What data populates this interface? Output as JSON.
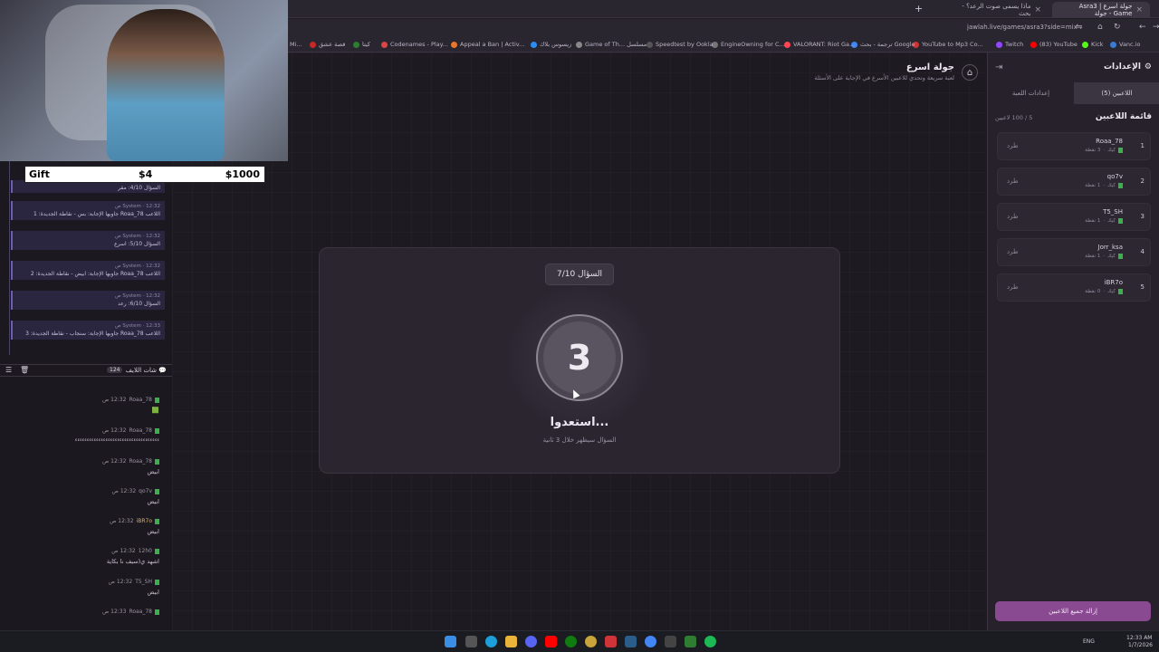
{
  "browser": {
    "tabs": [
      {
        "label": "جولة اسرع | Asra3 Game - جولة",
        "active": true
      },
      {
        "label": "ماذا يسمى صوت الرعد؟ - بحث",
        "active": false
      }
    ],
    "new_tab": "+",
    "url": "jawlah.live/games/asra3?side=mix",
    "bookmarks": [
      "Twitch",
      "(83) YouTube",
      "Kick",
      "Vanc.io",
      "YouTube to Mp3 Co...",
      "ترجمة - بحث Google",
      "VALORANT: Riot Ga...",
      "EngineOwning for C...",
      "Speedtest by Ookla",
      "Game of Th... مسلسل",
      "زيسوس بلاك",
      "Appeal a Ban | Activ...",
      "Codenames - Play...",
      "كيتا",
      "قصة عشق",
      "Mi..."
    ],
    "bookmark_colors": [
      "#9146ff",
      "#ff0000",
      "#53fc18",
      "#3a7bd5",
      "#cc3333",
      "#4285f4",
      "#ff4655",
      "#555",
      "#333",
      "#888",
      "#2b8cf2",
      "#e8762c",
      "#dd4444",
      "#2e7d32",
      "#c62828",
      "#666"
    ]
  },
  "page": {
    "title": "جولة اسرع",
    "subtitle": "لعبة سريعة وتحدي للاعبين الأسرع في الإجابة على الأسئلة",
    "question_badge": "السؤال 7/10",
    "countdown": "3",
    "ready_text": "استعدوا...",
    "ready_sub": "السؤال سيظهر خلال 3 ثانية"
  },
  "settings": {
    "title": "الإعدادات",
    "tab_players": "اللاعبين (5)",
    "tab_game": "إعدادات اللعبة",
    "players_title": "قائمة اللاعبين",
    "players_count": "5 / 100 لاعبين",
    "kick_label": "طرد",
    "players": [
      {
        "num": "1",
        "name": "Roaa_78",
        "status": "3 نقطة",
        "state": "كيك"
      },
      {
        "num": "2",
        "name": "qo7v",
        "status": "1 نقطة",
        "state": "كيك"
      },
      {
        "num": "3",
        "name": "T5_SH",
        "status": "1 نقطة",
        "state": "كيك"
      },
      {
        "num": "4",
        "name": "Jorr_ksa",
        "status": "1 نقطة",
        "state": "كيك"
      },
      {
        "num": "5",
        "name": "iBR7o",
        "status": "0 نقطة",
        "state": "كيك"
      }
    ],
    "remove_all": "إزالة جميع اللاعبين"
  },
  "overlay": {
    "gift_label": "Gift",
    "gift_amount": "$4",
    "gift_goal": "$1000"
  },
  "system_log": [
    {
      "time": "12:32 ص",
      "who": "System",
      "text": "السؤال 4/10: مقر"
    },
    {
      "time": "12:32 ص",
      "who": "System",
      "text": "اللاعب Roaa_78 جاوبها الإجابة: بس - نقاطة الجديدة: 1"
    },
    {
      "time": "12:32 ص",
      "who": "System",
      "text": "السؤال 5/10: اسرع"
    },
    {
      "time": "12:32 ص",
      "who": "System",
      "text": "اللاعب Roaa_78 جاوبها الإجابة: ابيض - نقاطة الجديدة: 2"
    },
    {
      "time": "12:32 ص",
      "who": "System",
      "text": "السؤال 6/10: رعد"
    },
    {
      "time": "12:33 ص",
      "who": "System",
      "text": "اللاعب Roaa_78 جاوبها الإجابة: سنجاب - نقاطة الجديدة: 3"
    }
  ],
  "chat": {
    "title": "شات اللايف",
    "count": "124",
    "messages": [
      {
        "user": "Roaa_78",
        "time": "12:32 ص",
        "text": "🟩"
      },
      {
        "user": "Roaa_78",
        "time": "12:32 ص",
        "text": "ءءءءءءءءءءءءءءءءءءءءءءءءءءءءءءءءءءءء"
      },
      {
        "user": "Roaa_78",
        "time": "12:32 ص",
        "text": "ابيض"
      },
      {
        "user": "qo7v",
        "time": "12:32 ص",
        "text": "ابيض"
      },
      {
        "user": "iBR7o",
        "time": "12:32 ص",
        "text": "ابيض"
      },
      {
        "user": "12h0",
        "time": "12:32 ص",
        "text": "اشهد ي(سيف نا بكاية"
      },
      {
        "user": "T5_SH",
        "time": "12:32 ص",
        "text": "ابيض"
      },
      {
        "user": "Roaa_78",
        "time": "12:33 ص",
        "text": ""
      }
    ]
  },
  "taskbar": {
    "lang": "ENG",
    "time": "12:33 AM",
    "date": "1/7/2026"
  }
}
